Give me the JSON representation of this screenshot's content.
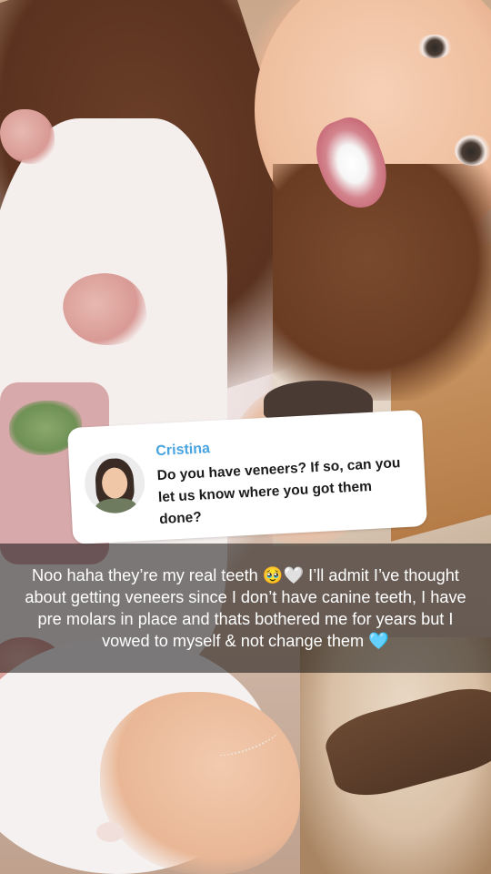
{
  "question_sticker": {
    "name": "Cristina",
    "question": "Do you have veneers? If so, can you let us know where you got them done?"
  },
  "caption": {
    "text": "Noo haha they’re my real teeth 🥹🤍 I’ll admit I’ve thought about getting veneers since I don’t have canine teeth, I have pre molars in place and thats bothered me for years but I vowed to myself & not change them 🩵"
  },
  "colors": {
    "name_accent": "#4aa4e0",
    "caption_bg": "rgba(0,0,0,0.5)"
  }
}
